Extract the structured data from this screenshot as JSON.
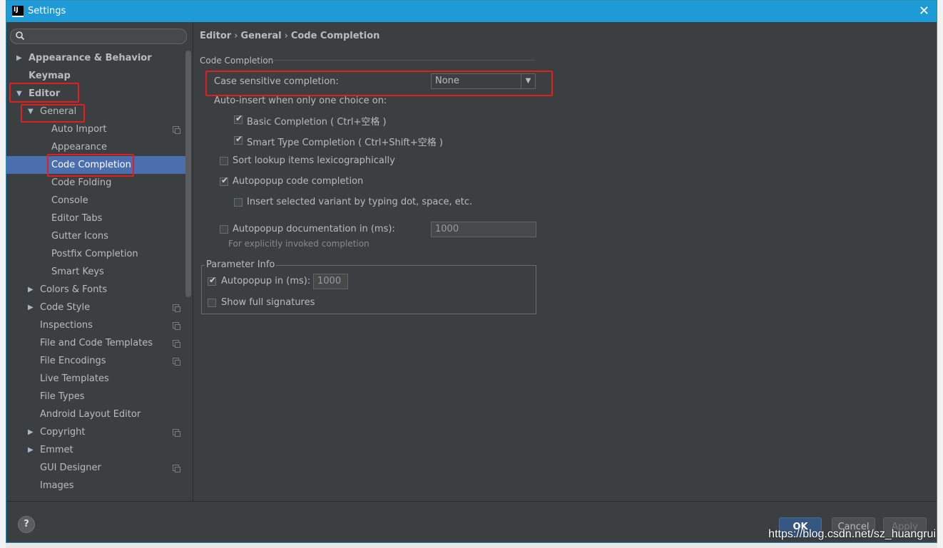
{
  "window": {
    "title": "Settings",
    "logo_text": "IJ",
    "close": "✕"
  },
  "search": {
    "placeholder": "",
    "icon": "magnifier"
  },
  "tree": [
    {
      "label": "Appearance & Behavior",
      "arrow": "▶"
    },
    {
      "label": "Keymap"
    },
    {
      "label": "Editor",
      "arrow": "▼"
    },
    {
      "label": "General",
      "arrow": "▼"
    },
    {
      "label": "Auto Import"
    },
    {
      "label": "Appearance"
    },
    {
      "label": "Code Completion"
    },
    {
      "label": "Code Folding"
    },
    {
      "label": "Console"
    },
    {
      "label": "Editor Tabs"
    },
    {
      "label": "Gutter Icons"
    },
    {
      "label": "Postfix Completion"
    },
    {
      "label": "Smart Keys"
    },
    {
      "label": "Colors & Fonts",
      "arrow": "▶"
    },
    {
      "label": "Code Style",
      "arrow": "▶"
    },
    {
      "label": "Inspections"
    },
    {
      "label": "File and Code Templates"
    },
    {
      "label": "File Encodings"
    },
    {
      "label": "Live Templates"
    },
    {
      "label": "File Types"
    },
    {
      "label": "Android Layout Editor"
    },
    {
      "label": "Copyright",
      "arrow": "▶"
    },
    {
      "label": "Emmet",
      "arrow": "▶"
    },
    {
      "label": "GUI Designer"
    },
    {
      "label": "Images"
    }
  ],
  "breadcrumb": [
    "Editor",
    "General",
    "Code Completion"
  ],
  "breadcrumb_sep": "›",
  "section_title": "Code Completion",
  "case_sensitive": {
    "label": "Case sensitive completion:",
    "value": "None"
  },
  "auto_insert_label": "Auto-insert when only one choice on:",
  "options": {
    "basic": {
      "label": "Basic Completion ( Ctrl+空格 )",
      "checked": true
    },
    "smart": {
      "label": "Smart Type Completion ( Ctrl+Shift+空格 )",
      "checked": true
    },
    "sort": {
      "label": "Sort lookup items lexicographically",
      "checked": false
    },
    "autopopup": {
      "label": "Autopopup code completion",
      "checked": true
    },
    "insert_variant": {
      "label": "Insert selected variant by typing dot, space, etc.",
      "checked": false
    },
    "autopopup_doc": {
      "label": "Autopopup documentation in (ms):",
      "checked": false,
      "value": "1000"
    }
  },
  "doc_hint": "For explicitly invoked completion",
  "param_info": {
    "title": "Parameter Info",
    "autopopup": {
      "label": "Autopopup in (ms):",
      "checked": true,
      "value": "1000"
    },
    "full_sig": {
      "label": "Show full signatures",
      "checked": false
    }
  },
  "footer": {
    "help": "?",
    "ok": "OK",
    "cancel": "Cancel",
    "apply": "Apply"
  },
  "watermark": "https://blog.csdn.net/sz_huangrui",
  "colors": {
    "accent": "#1e9bd7",
    "selection": "#4b6eaf",
    "highlight_box": "#e02020"
  }
}
